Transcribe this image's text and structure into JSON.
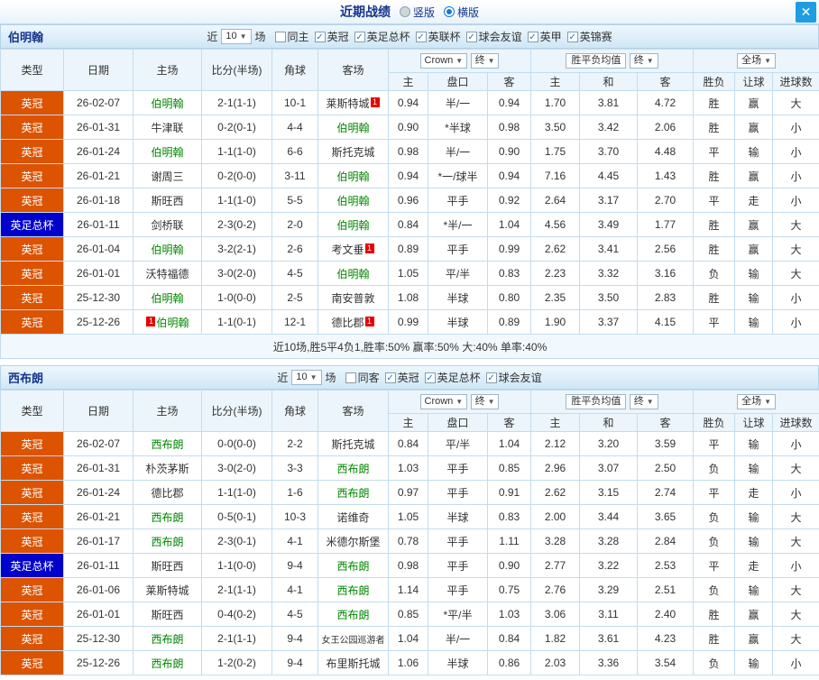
{
  "titlebar": {
    "title": "近期战绩",
    "radios": [
      {
        "label": "竖版",
        "selected": false
      },
      {
        "label": "横版",
        "selected": true
      }
    ],
    "close_icon": "✕"
  },
  "colors": {
    "league_badge": "#dc5302",
    "cup_badge": "#0101cb",
    "win_text": "#e80000",
    "draw_text": "#2222dd",
    "loss_text": "#008800",
    "focal_team": "#008800",
    "close_button": "#1e9de3"
  },
  "sections": [
    {
      "team": "伯明翰",
      "near_label": "近",
      "count": "10",
      "games_label": "场",
      "filters": [
        {
          "label": "同主",
          "checked": false
        },
        {
          "label": "英冠",
          "checked": true
        },
        {
          "label": "英足总杯",
          "checked": true
        },
        {
          "label": "英联杯",
          "checked": true
        },
        {
          "label": "球会友谊",
          "checked": true
        },
        {
          "label": "英甲",
          "checked": true
        },
        {
          "label": "英锦赛",
          "checked": true
        }
      ],
      "header": {
        "type": "类型",
        "date": "日期",
        "home": "主场",
        "score": "比分(半场)",
        "corner": "角球",
        "away": "客场",
        "bookmaker": "Crown",
        "final1": "终",
        "odds_avg": "胜平负均值",
        "final2": "终",
        "full": "全场",
        "sub": [
          "主",
          "盘口",
          "客",
          "主",
          "和",
          "客",
          "胜负",
          "让球",
          "进球数"
        ]
      },
      "rows": [
        {
          "lg": "英冠",
          "date": "26-02-07",
          "home": {
            "name": "伯明翰",
            "focal": true
          },
          "score": "2-1(1-1)",
          "corner": "10-1",
          "away": {
            "name": "莱斯特城",
            "badge": "1"
          },
          "o1": "0.94",
          "o2": "半/一",
          "o3": "0.94",
          "e1": "1.70",
          "e2": "3.81",
          "e3": "4.72",
          "r1": "胜",
          "r2": "赢",
          "r3": "大"
        },
        {
          "lg": "英冠",
          "date": "26-01-31",
          "home": {
            "name": "牛津联"
          },
          "score": "0-2(0-1)",
          "corner": "4-4",
          "away": {
            "name": "伯明翰",
            "focal": true
          },
          "o1": "0.90",
          "o2": "*半球",
          "o3": "0.98",
          "e1": "3.50",
          "e2": "3.42",
          "e3": "2.06",
          "r1": "胜",
          "r2": "赢",
          "r3": "小"
        },
        {
          "lg": "英冠",
          "date": "26-01-24",
          "home": {
            "name": "伯明翰",
            "focal": true
          },
          "score": "1-1(1-0)",
          "corner": "6-6",
          "away": {
            "name": "斯托克城"
          },
          "o1": "0.98",
          "o2": "半/一",
          "o3": "0.90",
          "e1": "1.75",
          "e2": "3.70",
          "e3": "4.48",
          "r1": "平",
          "r2": "输",
          "r3": "小"
        },
        {
          "lg": "英冠",
          "date": "26-01-21",
          "home": {
            "name": "谢周三"
          },
          "score": "0-2(0-0)",
          "corner": "3-11",
          "away": {
            "name": "伯明翰",
            "focal": true
          },
          "o1": "0.94",
          "o2": "*一/球半",
          "o3": "0.94",
          "e1": "7.16",
          "e2": "4.45",
          "e3": "1.43",
          "r1": "胜",
          "r2": "赢",
          "r3": "小"
        },
        {
          "lg": "英冠",
          "date": "26-01-18",
          "home": {
            "name": "斯旺西"
          },
          "score": "1-1(1-0)",
          "corner": "5-5",
          "away": {
            "name": "伯明翰",
            "focal": true
          },
          "o1": "0.96",
          "o2": "平手",
          "o3": "0.92",
          "e1": "2.64",
          "e2": "3.17",
          "e3": "2.70",
          "r1": "平",
          "r2": "走",
          "r3": "小"
        },
        {
          "lg": "英足总杯",
          "cup": true,
          "date": "26-01-11",
          "home": {
            "name": "剑桥联"
          },
          "score": "2-3(0-2)",
          "corner": "2-0",
          "away": {
            "name": "伯明翰",
            "focal": true
          },
          "o1": "0.84",
          "o2": "*半/一",
          "o3": "1.04",
          "e1": "4.56",
          "e2": "3.49",
          "e3": "1.77",
          "r1": "胜",
          "r2": "赢",
          "r3": "大"
        },
        {
          "lg": "英冠",
          "date": "26-01-04",
          "home": {
            "name": "伯明翰",
            "focal": true
          },
          "score": "3-2(2-1)",
          "corner": "2-6",
          "away": {
            "name": "考文垂",
            "badge": "1"
          },
          "o1": "0.89",
          "o2": "平手",
          "o3": "0.99",
          "e1": "2.62",
          "e2": "3.41",
          "e3": "2.56",
          "r1": "胜",
          "r2": "赢",
          "r3": "大"
        },
        {
          "lg": "英冠",
          "date": "26-01-01",
          "home": {
            "name": "沃特福德"
          },
          "score": "3-0(2-0)",
          "corner": "4-5",
          "away": {
            "name": "伯明翰",
            "focal": true
          },
          "o1": "1.05",
          "o2": "平/半",
          "o3": "0.83",
          "e1": "2.23",
          "e2": "3.32",
          "e3": "3.16",
          "r1": "负",
          "r2": "输",
          "r3": "大"
        },
        {
          "lg": "英冠",
          "date": "25-12-30",
          "home": {
            "name": "伯明翰",
            "focal": true
          },
          "score": "1-0(0-0)",
          "corner": "2-5",
          "away": {
            "name": "南安普敦"
          },
          "o1": "1.08",
          "o2": "半球",
          "o3": "0.80",
          "e1": "2.35",
          "e2": "3.50",
          "e3": "2.83",
          "r1": "胜",
          "r2": "输",
          "r3": "小"
        },
        {
          "lg": "英冠",
          "date": "25-12-26",
          "home": {
            "name": "伯明翰",
            "focal": true,
            "badge": "1",
            "badge_pos": "pre"
          },
          "score": "1-1(0-1)",
          "corner": "12-1",
          "away": {
            "name": "德比郡",
            "badge": "1"
          },
          "o1": "0.99",
          "o2": "半球",
          "o3": "0.89",
          "e1": "1.90",
          "e2": "3.37",
          "e3": "4.15",
          "r1": "平",
          "r2": "输",
          "r3": "小"
        }
      ],
      "summary": "近10场,胜5平4负1,胜率:50% 赢率:50% 大:40% 单率:40%"
    },
    {
      "team": "西布朗",
      "near_label": "近",
      "count": "10",
      "games_label": "场",
      "filters": [
        {
          "label": "同客",
          "checked": false
        },
        {
          "label": "英冠",
          "checked": true
        },
        {
          "label": "英足总杯",
          "checked": true
        },
        {
          "label": "球会友谊",
          "checked": true
        }
      ],
      "header": {
        "type": "类型",
        "date": "日期",
        "home": "主场",
        "score": "比分(半场)",
        "corner": "角球",
        "away": "客场",
        "bookmaker": "Crown",
        "final1": "终",
        "odds_avg": "胜平负均值",
        "final2": "终",
        "full": "全场",
        "sub": [
          "主",
          "盘口",
          "客",
          "主",
          "和",
          "客",
          "胜负",
          "让球",
          "进球数"
        ]
      },
      "rows": [
        {
          "lg": "英冠",
          "date": "26-02-07",
          "home": {
            "name": "西布朗",
            "focal": true
          },
          "score": "0-0(0-0)",
          "corner": "2-2",
          "away": {
            "name": "斯托克城"
          },
          "o1": "0.84",
          "o2": "平/半",
          "o3": "1.04",
          "e1": "2.12",
          "e2": "3.20",
          "e3": "3.59",
          "r1": "平",
          "r2": "输",
          "r3": "小"
        },
        {
          "lg": "英冠",
          "date": "26-01-31",
          "home": {
            "name": "朴茨茅斯"
          },
          "score": "3-0(2-0)",
          "corner": "3-3",
          "away": {
            "name": "西布朗",
            "focal": true
          },
          "o1": "1.03",
          "o2": "平手",
          "o3": "0.85",
          "e1": "2.96",
          "e2": "3.07",
          "e3": "2.50",
          "r1": "负",
          "r2": "输",
          "r3": "大"
        },
        {
          "lg": "英冠",
          "date": "26-01-24",
          "home": {
            "name": "德比郡"
          },
          "score": "1-1(1-0)",
          "corner": "1-6",
          "away": {
            "name": "西布朗",
            "focal": true
          },
          "o1": "0.97",
          "o2": "平手",
          "o3": "0.91",
          "e1": "2.62",
          "e2": "3.15",
          "e3": "2.74",
          "r1": "平",
          "r2": "走",
          "r3": "小"
        },
        {
          "lg": "英冠",
          "date": "26-01-21",
          "home": {
            "name": "西布朗",
            "focal": true
          },
          "score": "0-5(0-1)",
          "corner": "10-3",
          "away": {
            "name": "诺维奇"
          },
          "o1": "1.05",
          "o2": "半球",
          "o3": "0.83",
          "e1": "2.00",
          "e2": "3.44",
          "e3": "3.65",
          "r1": "负",
          "r2": "输",
          "r3": "大"
        },
        {
          "lg": "英冠",
          "date": "26-01-17",
          "home": {
            "name": "西布朗",
            "focal": true
          },
          "score": "2-3(0-1)",
          "corner": "4-1",
          "away": {
            "name": "米德尔斯堡"
          },
          "o1": "0.78",
          "o2": "平手",
          "o3": "1.11",
          "e1": "3.28",
          "e2": "3.28",
          "e3": "2.84",
          "r1": "负",
          "r2": "输",
          "r3": "大"
        },
        {
          "lg": "英足总杯",
          "cup": true,
          "date": "26-01-11",
          "home": {
            "name": "斯旺西"
          },
          "score": "1-1(0-0)",
          "corner": "9-4",
          "away": {
            "name": "西布朗",
            "focal": true
          },
          "o1": "0.98",
          "o2": "平手",
          "o3": "0.90",
          "e1": "2.77",
          "e2": "3.22",
          "e3": "2.53",
          "r1": "平",
          "r2": "走",
          "r3": "小"
        },
        {
          "lg": "英冠",
          "date": "26-01-06",
          "home": {
            "name": "莱斯特城"
          },
          "score": "2-1(1-1)",
          "corner": "4-1",
          "away": {
            "name": "西布朗",
            "focal": true
          },
          "o1": "1.14",
          "o2": "平手",
          "o3": "0.75",
          "e1": "2.76",
          "e2": "3.29",
          "e3": "2.51",
          "r1": "负",
          "r2": "输",
          "r3": "大"
        },
        {
          "lg": "英冠",
          "date": "26-01-01",
          "home": {
            "name": "斯旺西"
          },
          "score": "0-4(0-2)",
          "corner": "4-5",
          "away": {
            "name": "西布朗",
            "focal": true
          },
          "o1": "0.85",
          "o2": "*平/半",
          "o3": "1.03",
          "e1": "3.06",
          "e2": "3.11",
          "e3": "2.40",
          "r1": "胜",
          "r2": "赢",
          "r3": "大"
        },
        {
          "lg": "英冠",
          "date": "25-12-30",
          "home": {
            "name": "西布朗",
            "focal": true
          },
          "score": "2-1(1-1)",
          "corner": "9-4",
          "away": {
            "name": "女王公园巡游者"
          },
          "o1": "1.04",
          "o2": "半/一",
          "o3": "0.84",
          "e1": "1.82",
          "e2": "3.61",
          "e3": "4.23",
          "r1": "胜",
          "r2": "赢",
          "r3": "大"
        },
        {
          "lg": "英冠",
          "date": "25-12-26",
          "home": {
            "name": "西布朗",
            "focal": true
          },
          "score": "1-2(0-2)",
          "corner": "9-4",
          "away": {
            "name": "布里斯托城"
          },
          "o1": "1.06",
          "o2": "半球",
          "o3": "0.86",
          "e1": "2.03",
          "e2": "3.36",
          "e3": "3.54",
          "r1": "负",
          "r2": "输",
          "r3": "小"
        }
      ]
    }
  ]
}
